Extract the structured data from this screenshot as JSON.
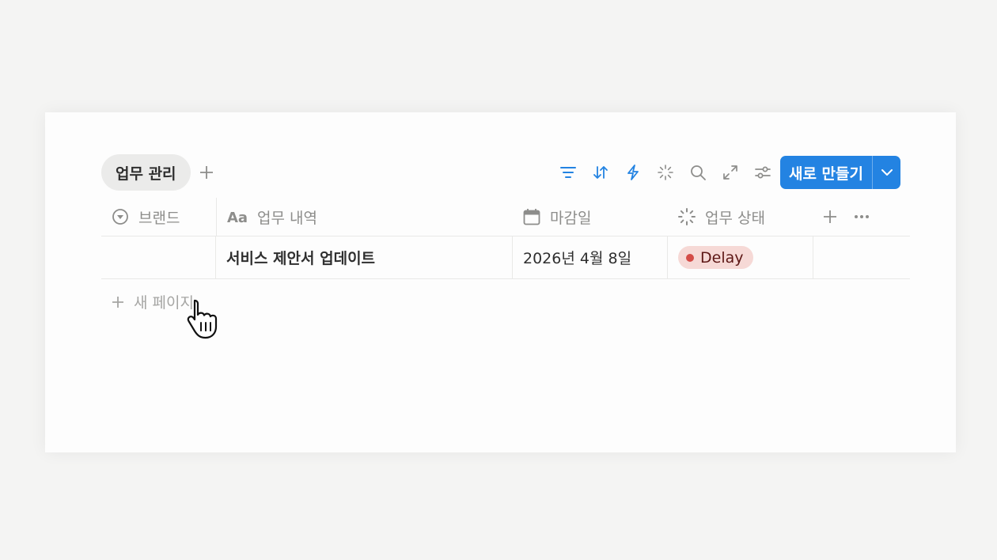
{
  "view_tabs": [
    {
      "label": "업무 관리",
      "active": true
    }
  ],
  "toolbar": {
    "icons": [
      "filter-icon",
      "sort-icon",
      "automation-icon",
      "ai-sparkle-icon",
      "search-icon",
      "expand-icon",
      "settings-sliders-icon"
    ],
    "new_button_label": "새로 만들기",
    "accent_color": "#2383e2"
  },
  "table": {
    "columns": [
      {
        "label": "브랜드",
        "icon": "select-icon"
      },
      {
        "label": "업무 내역",
        "icon": "title-text-icon"
      },
      {
        "label": "마감일",
        "icon": "calendar-icon"
      },
      {
        "label": "업무 상태",
        "icon": "status-icon"
      }
    ],
    "rows": [
      {
        "brand": "",
        "task": "서비스 제안서 업데이트",
        "due_date": "2026년 4월 8일",
        "status": {
          "label": "Delay",
          "color": "#d44c47",
          "bg": "#f6d9d6"
        }
      }
    ],
    "new_page_label": "새 페이지"
  }
}
